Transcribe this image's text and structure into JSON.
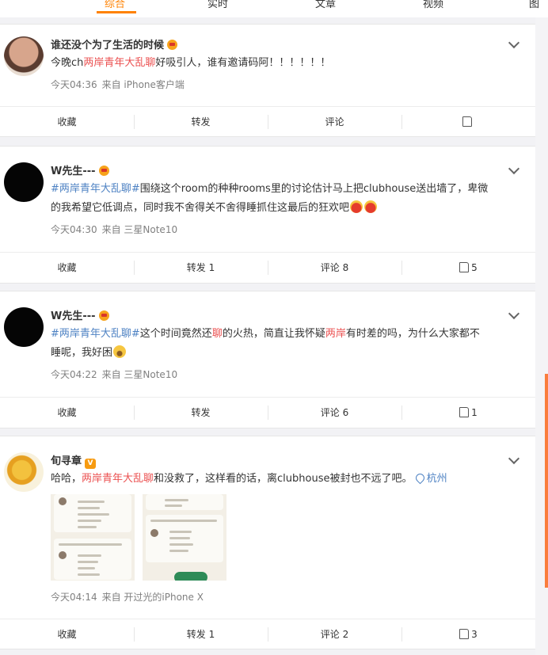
{
  "nav": {
    "tabs": [
      "综合",
      "实时",
      "文章",
      "视频",
      "图"
    ]
  },
  "posts": [
    {
      "nick": "谁还没个为了生活的时候",
      "text_pre": "今晚ch",
      "topic": "两岸青年大乱聊",
      "text_post": "好吸引人，谁有邀请码阿！！！！！！",
      "time": "今天04:36",
      "source": "来自 iPhone客户端",
      "actions": {
        "fav": "收藏",
        "repost": "转发",
        "comment": "评论",
        "like": ""
      }
    },
    {
      "nick": "W先生---",
      "topic_tag": "#两岸青年大乱聊#",
      "text_1": "围绕这个room的种种rooms里的讨论估计马上把clubhouse送出墙了，卑微",
      "text_2": "的我希望它低调点，同时我不舍得关不舍得睡抓住这最后的狂欢吧",
      "time": "今天04:30",
      "source": "来自 三星Note10",
      "actions": {
        "fav": "收藏",
        "repost": "转发 1",
        "comment": "评论 8",
        "like": "5"
      }
    },
    {
      "nick": "W先生---",
      "topic_tag": "#两岸青年大乱聊#",
      "text_1": "这个时间竟然还",
      "hl_1": "聊",
      "text_2": "的火热，简直让我怀疑",
      "hl_2": "两岸",
      "text_3": "有时差的吗，为什么大家都不",
      "text_4": "睡呢，我好困",
      "time": "今天04:22",
      "source": "来自 三星Note10",
      "actions": {
        "fav": "收藏",
        "repost": "转发",
        "comment": "评论 6",
        "like": "1"
      }
    },
    {
      "nick": "旬寻章",
      "text_pre": "哈哈，",
      "topic": "两岸青年大乱聊",
      "text_post": "和没救了，这样看的话，离clubhouse被封也不远了吧。",
      "location": "杭州",
      "time": "今天04:14",
      "source": "来自 开过光的iPhone X",
      "actions": {
        "fav": "收藏",
        "repost": "转发 1",
        "comment": "评论 2",
        "like": "3"
      }
    }
  ],
  "colors": {
    "accent": "#ff8200",
    "topic": "#eb5050",
    "link": "#4e82c3"
  }
}
